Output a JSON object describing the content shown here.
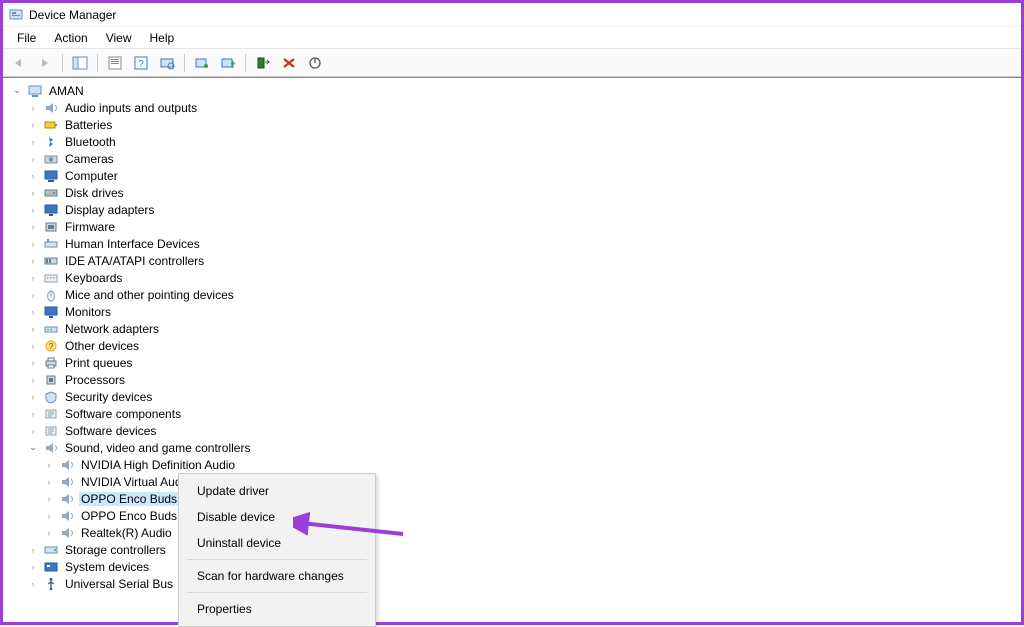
{
  "window": {
    "title": "Device Manager"
  },
  "menubar": [
    "File",
    "Action",
    "View",
    "Help"
  ],
  "tree": {
    "root": {
      "label": "AMAN",
      "expanded": true,
      "children": [
        {
          "label": "Audio inputs and outputs",
          "icon": "audio"
        },
        {
          "label": "Batteries",
          "icon": "battery"
        },
        {
          "label": "Bluetooth",
          "icon": "bluetooth"
        },
        {
          "label": "Cameras",
          "icon": "camera"
        },
        {
          "label": "Computer",
          "icon": "computer"
        },
        {
          "label": "Disk drives",
          "icon": "disk"
        },
        {
          "label": "Display adapters",
          "icon": "display"
        },
        {
          "label": "Firmware",
          "icon": "firmware"
        },
        {
          "label": "Human Interface Devices",
          "icon": "hid"
        },
        {
          "label": "IDE ATA/ATAPI controllers",
          "icon": "ide"
        },
        {
          "label": "Keyboards",
          "icon": "keyboard"
        },
        {
          "label": "Mice and other pointing devices",
          "icon": "mouse"
        },
        {
          "label": "Monitors",
          "icon": "monitor"
        },
        {
          "label": "Network adapters",
          "icon": "network"
        },
        {
          "label": "Other devices",
          "icon": "other"
        },
        {
          "label": "Print queues",
          "icon": "printer"
        },
        {
          "label": "Processors",
          "icon": "cpu"
        },
        {
          "label": "Security devices",
          "icon": "security"
        },
        {
          "label": "Software components",
          "icon": "software"
        },
        {
          "label": "Software devices",
          "icon": "software"
        },
        {
          "label": "Sound, video and game controllers",
          "icon": "sound",
          "expanded": true,
          "children": [
            {
              "label": "NVIDIA High Definition Audio",
              "icon": "sound"
            },
            {
              "label": "NVIDIA Virtual Audio Device (Wave Extensible) (WDM)",
              "icon": "sound"
            },
            {
              "label": "OPPO Enco Buds",
              "icon": "sound",
              "selected": true
            },
            {
              "label": "OPPO Enco Buds",
              "icon": "sound"
            },
            {
              "label": "Realtek(R) Audio",
              "icon": "sound"
            }
          ]
        },
        {
          "label": "Storage controllers",
          "icon": "storage"
        },
        {
          "label": "System devices",
          "icon": "system"
        },
        {
          "label": "Universal Serial Bus",
          "icon": "usb"
        }
      ]
    }
  },
  "context_menu": [
    {
      "label": "Update driver"
    },
    {
      "label": "Disable device"
    },
    {
      "label": "Uninstall device"
    },
    {
      "sep": true
    },
    {
      "label": "Scan for hardware changes"
    },
    {
      "sep": true
    },
    {
      "label": "Properties"
    }
  ],
  "annotation": {
    "arrow_color": "#9b3fd8"
  }
}
